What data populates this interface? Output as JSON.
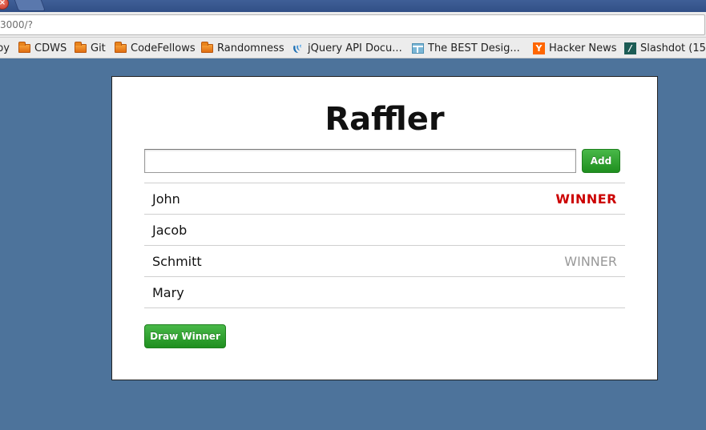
{
  "browser": {
    "url": "3000/?",
    "close_glyph": "×"
  },
  "bookmarks": [
    {
      "label": "py",
      "icon": "none"
    },
    {
      "label": "CDWS",
      "icon": "folder-icon"
    },
    {
      "label": "Git",
      "icon": "folder-icon"
    },
    {
      "label": "CodeFellows",
      "icon": "folder-icon"
    },
    {
      "label": "Randomness",
      "icon": "folder-icon"
    },
    {
      "label": "jQuery API Docu...",
      "icon": "jquery-icon"
    },
    {
      "label": "The BEST Desig...",
      "icon": "layout-icon"
    },
    {
      "label": "Hacker News",
      "icon": "hacker-news-icon",
      "glyph": "Y"
    },
    {
      "label": "Slashdot (15",
      "icon": "slashdot-icon",
      "glyph": "/"
    }
  ],
  "app": {
    "title": "Raffler",
    "input_value": "",
    "add_label": "Add",
    "draw_label": "Draw Winner",
    "entries": [
      {
        "name": "John",
        "winner_label": "WINNER",
        "winner_state": "current"
      },
      {
        "name": "Jacob",
        "winner_label": "",
        "winner_state": "none"
      },
      {
        "name": "Schmitt",
        "winner_label": "WINNER",
        "winner_state": "past"
      },
      {
        "name": "Mary",
        "winner_label": "",
        "winner_state": "none"
      }
    ]
  },
  "colors": {
    "page_background": "#4d739b",
    "button_green": "#2a9a2a",
    "current_winner": "#cc0000",
    "past_winner": "#999999"
  }
}
